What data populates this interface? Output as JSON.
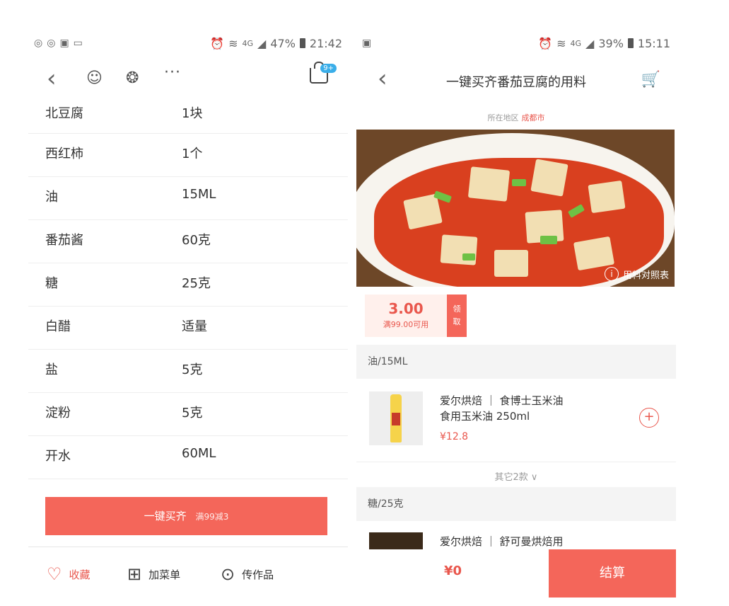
{
  "left": {
    "status": {
      "time": "21:42",
      "battery": "47%",
      "net": "4G"
    },
    "badge": "9+",
    "ingredients": [
      {
        "name": "北豆腐",
        "qty": "1块"
      },
      {
        "name": "西红柿",
        "qty": "1个"
      },
      {
        "name": "油",
        "qty": "15ML"
      },
      {
        "name": "番茄酱",
        "qty": "60克"
      },
      {
        "name": "糖",
        "qty": "25克"
      },
      {
        "name": "白醋",
        "qty": "适量"
      },
      {
        "name": "盐",
        "qty": "5克"
      },
      {
        "name": "淀粉",
        "qty": "5克"
      },
      {
        "name": "开水",
        "qty": "60ML"
      }
    ],
    "buy_all": {
      "label": "一键买齐",
      "promo": "满99减3"
    },
    "footer": {
      "fav": "收藏",
      "add_menu": "加菜单",
      "upload": "传作品"
    },
    "icons": {
      "more": "···"
    }
  },
  "right": {
    "status": {
      "time": "15:11",
      "battery": "39%",
      "net": "4G"
    },
    "title": "一键买齐番茄豆腐的用料",
    "region": {
      "label": "所在地区",
      "city": "成都市"
    },
    "photo_hint": "用料对照表",
    "coupon": {
      "amount": "3.00",
      "condition": "满99.00可用",
      "claim1": "领",
      "claim2": "取"
    },
    "sections": [
      {
        "label": "油/15ML"
      },
      {
        "label": "糖/25克"
      }
    ],
    "products": [
      {
        "line1": "爱尔烘焙 ｜ 食博士玉米油",
        "line2": "食用玉米油 250ml",
        "price": "¥12.8"
      },
      {
        "line1": "爱尔烘焙 ｜ 舒可曼烘焙用"
      }
    ],
    "others": "其它2款 ∨",
    "total": "¥0",
    "checkout": "结算"
  }
}
